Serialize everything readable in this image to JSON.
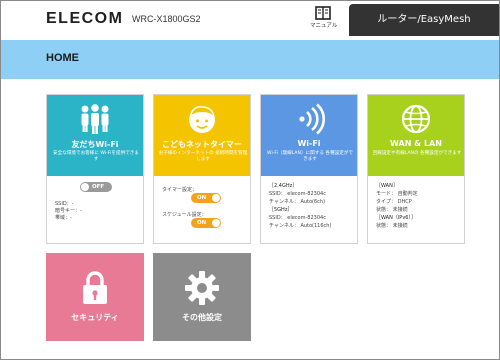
{
  "header": {
    "logo": "ELECOM",
    "model": "WRC-X1800GS2",
    "manual_label": "マニュアル",
    "mode_button": "ルーター/EasyMesh"
  },
  "page": {
    "title": "HOME"
  },
  "colors": {
    "band": "#8ecff6",
    "kids_wifi": "#2bb3c8",
    "kids_timer": "#f5c400",
    "wifi": "#5b97e3",
    "wan_lan": "#a7d11d",
    "security": "#e87a95",
    "other": "#8c8c8c"
  },
  "cards": {
    "kids_wifi": {
      "icon": "people-icon",
      "title": "友だちWi-Fi",
      "desc": "安全な環境でお客様に Wi-Fiを提供できます",
      "toggle": "OFF",
      "lines": [
        "SSID：-",
        "暗号キー：-",
        "帯域：-"
      ]
    },
    "kids_timer": {
      "icon": "child-face-icon",
      "title": "こどもネットタイマー",
      "desc": "お子様のインターネットの 接続時間を管理します",
      "timer_label": "タイマー設定：",
      "timer_value": "ON",
      "schedule_label": "スケジュール設定：",
      "schedule_value": "ON"
    },
    "wifi": {
      "icon": "wifi-icon",
      "title": "Wi-Fi",
      "desc": "Wi-Fi（無線LAN）に関する 各種設定ができます",
      "lines": [
        "［2.4GHz］",
        "SSID：  elecom-82304c",
        "チャンネル：  Auto(6ch)",
        "［5GHz］",
        "SSID：  elecom-82304c",
        "チャンネル：  Auto(116ch)"
      ]
    },
    "wan_lan": {
      "icon": "globe-icon",
      "title": "WAN & LAN",
      "desc": "回線設定や有線LANの 各種設定ができます",
      "lines": [
        "［WAN］",
        "モード：  自動判定",
        "タイプ：  DHCP",
        "状態：  未接続",
        "［WAN（IPv6）］",
        "状態：  未接続"
      ]
    },
    "security": {
      "icon": "lock-icon",
      "title": "セキュリティ"
    },
    "other": {
      "icon": "gear-icon",
      "title": "その他設定"
    }
  }
}
